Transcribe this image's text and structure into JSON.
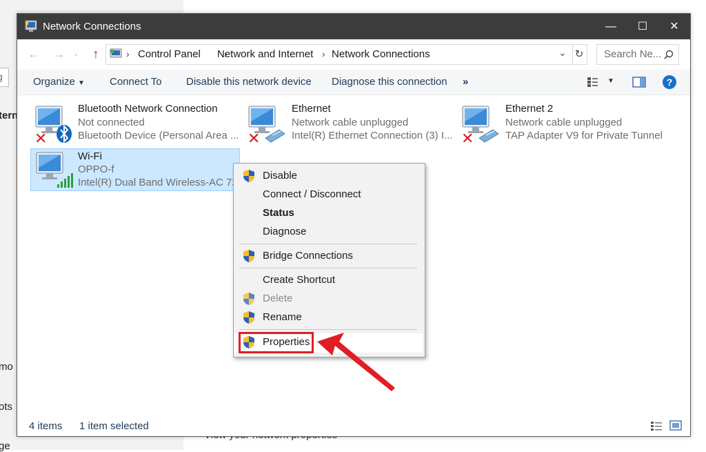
{
  "background": {
    "left_fragments": [
      "tern",
      "mo",
      "ots",
      "ge"
    ],
    "search_fragment": "g",
    "bottom_text": "View your network properties"
  },
  "window": {
    "title": "Network Connections",
    "controls": {
      "minimize": "—",
      "maximize": "☐",
      "close": "✕"
    }
  },
  "address": {
    "breadcrumbs": [
      "Control Panel",
      "Network and Internet",
      "Network Connections"
    ],
    "search_placeholder": "Search Ne..."
  },
  "toolbar": {
    "organize": "Organize",
    "connect_to": "Connect To",
    "disable": "Disable this network device",
    "diagnose": "Diagnose this connection",
    "more": "»"
  },
  "connections": [
    {
      "name": "Bluetooth Network Connection",
      "status": "Not connected",
      "device": "Bluetooth Device (Personal Area ...",
      "icon": "bluetooth-adapter-icon",
      "state": "disconnected"
    },
    {
      "name": "Ethernet",
      "status": "Network cable unplugged",
      "device": "Intel(R) Ethernet Connection (3) I...",
      "icon": "ethernet-adapter-icon",
      "state": "disconnected"
    },
    {
      "name": "Ethernet 2",
      "status": "Network cable unplugged",
      "device": "TAP Adapter V9 for Private Tunnel",
      "icon": "ethernet-adapter-icon",
      "state": "disconnected"
    },
    {
      "name": "Wi-Fi",
      "status": "OPPO-f",
      "device": "Intel(R) Dual Band Wireless-AC 72...",
      "icon": "wifi-adapter-icon",
      "state": "selected"
    }
  ],
  "context_menu": {
    "items": [
      {
        "label": "Disable",
        "shield": true
      },
      {
        "label": "Connect / Disconnect",
        "shield": false
      },
      {
        "label": "Status",
        "shield": false,
        "bold": true
      },
      {
        "label": "Diagnose",
        "shield": false
      },
      {
        "label": "Bridge Connections",
        "shield": true
      },
      {
        "label": "Create Shortcut",
        "shield": false
      },
      {
        "label": "Delete",
        "shield": true,
        "disabled": true
      },
      {
        "label": "Rename",
        "shield": true
      },
      {
        "label": "Properties",
        "shield": true,
        "highlighted": true
      }
    ]
  },
  "statusbar": {
    "items_count": "4 items",
    "selected": "1 item selected"
  },
  "colors": {
    "titlebar": "#3c3c3c",
    "selection": "#cce8ff",
    "annotation_red": "#e01e24",
    "link_blue": "#1e3b58"
  }
}
